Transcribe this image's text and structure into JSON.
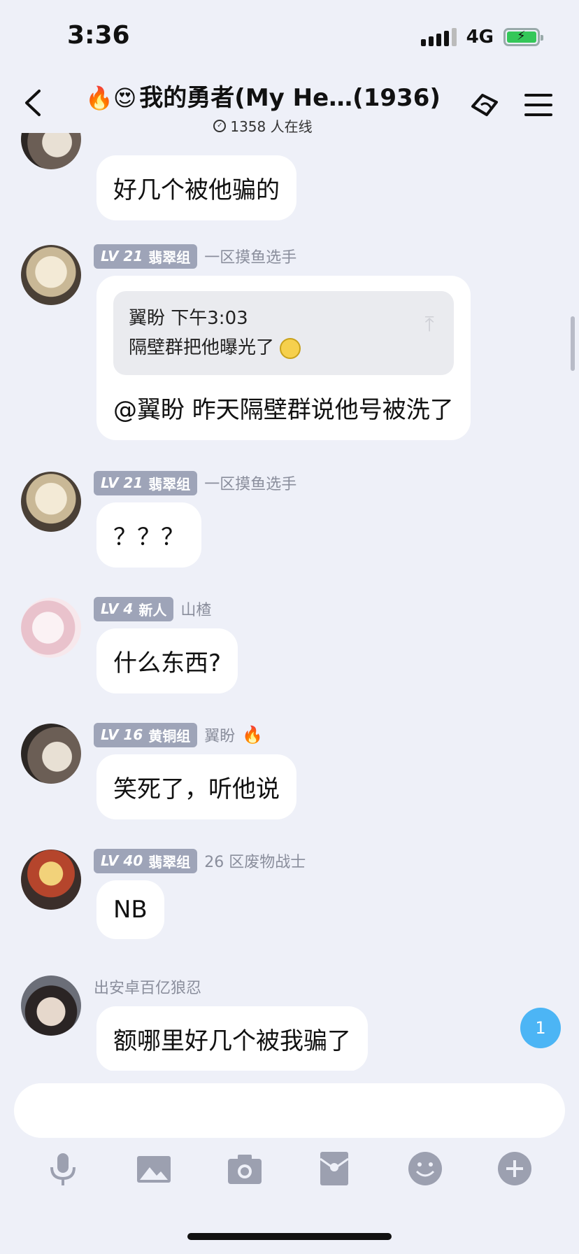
{
  "status": {
    "time": "3:36",
    "network": "4G"
  },
  "header": {
    "title": "我的勇者(My He…(1936)",
    "title_emojis": "🔥😍",
    "online": "1358 人在线"
  },
  "messages": [
    {
      "id": 0,
      "text": "好几个被他骗的"
    },
    {
      "id": 1,
      "level": "LV 21",
      "group": "翡翠组",
      "user": "一区摸鱼选手",
      "quote": {
        "author_time": "翼盼 下午3:03",
        "text": "隔壁群把他曝光了"
      },
      "text": "@翼盼 昨天隔壁群说他号被洗了"
    },
    {
      "id": 2,
      "level": "LV 21",
      "group": "翡翠组",
      "user": "一区摸鱼选手",
      "text": "？？？"
    },
    {
      "id": 3,
      "level": "LV 4",
      "group": "新人",
      "user": "山楂",
      "text": "什么东西?"
    },
    {
      "id": 4,
      "level": "LV 16",
      "group": "黄铜组",
      "user": "翼盼",
      "user_emoji": "🔥",
      "text": "笑死了，听他说"
    },
    {
      "id": 5,
      "level": "LV 40",
      "group": "翡翠组",
      "user": "26 区废物战士",
      "text": "NB"
    },
    {
      "id": 6,
      "user": "出安卓百亿狼忍",
      "text": "额哪里好几个被我骗了"
    }
  ],
  "unread_count": "1",
  "input": {
    "placeholder": ""
  },
  "toolbar_icons": [
    "microphone-icon",
    "image-icon",
    "camera-icon",
    "red-packet-icon",
    "emoji-icon",
    "plus-icon"
  ],
  "colors": {
    "background": "#eef0f8",
    "level_badge": "#9ea4b8",
    "unread_badge": "#4cb5f5",
    "battery": "#34c759"
  }
}
